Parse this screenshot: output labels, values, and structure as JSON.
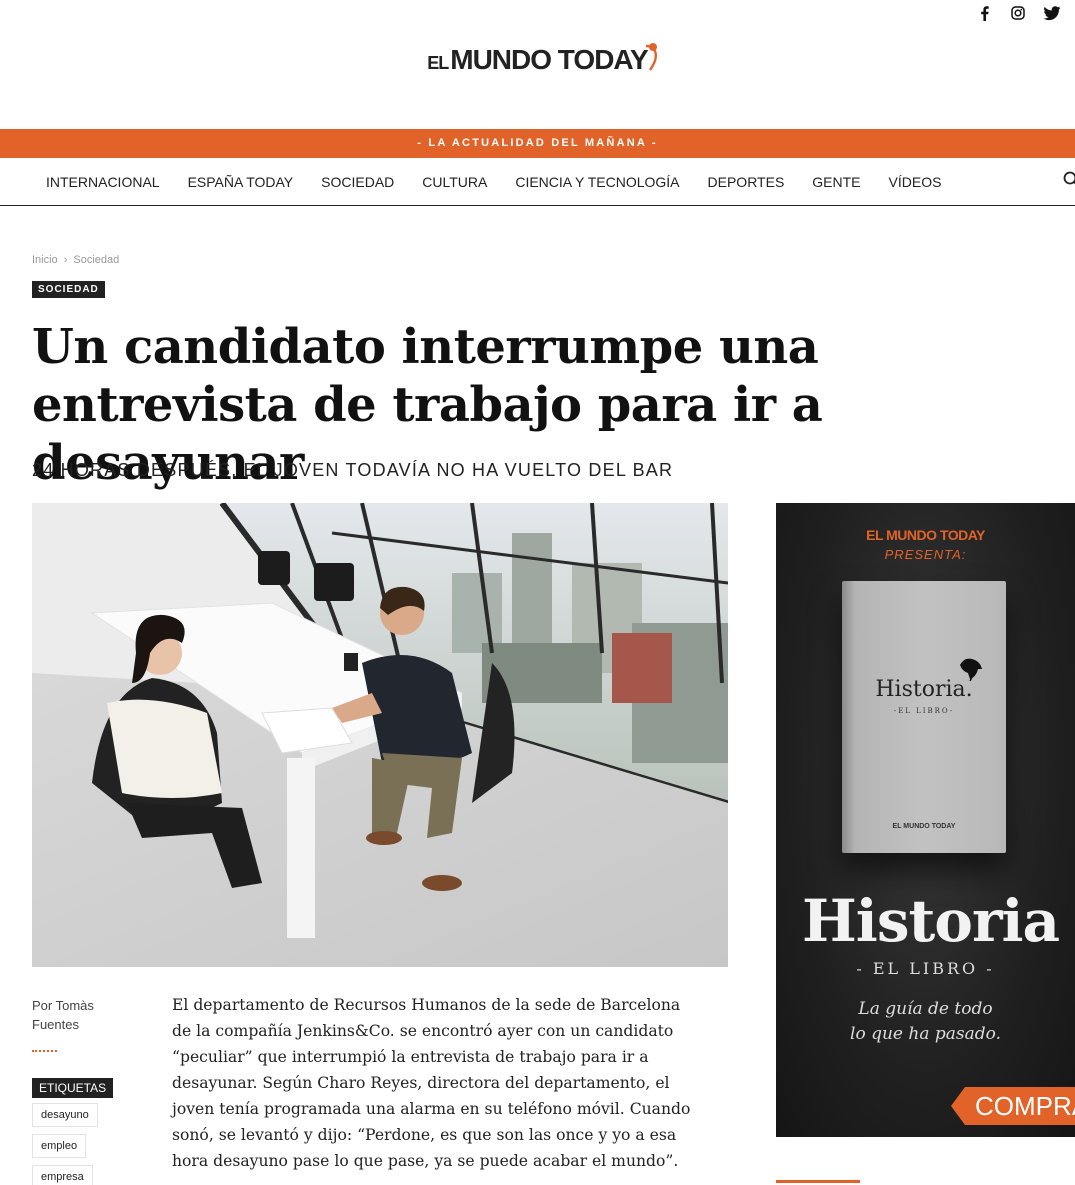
{
  "social": {
    "facebook_icon": "facebook-icon",
    "instagram_icon": "instagram-icon",
    "twitter_icon": "twitter-icon"
  },
  "logo": {
    "el": "EL",
    "main": "MUNDO TODAY",
    "color": "#222222",
    "accent": "#e2632a"
  },
  "tagline": "- LA ACTUALIDAD DEL MAÑANA  -",
  "nav": {
    "items": [
      {
        "label": "Internacional"
      },
      {
        "label": "España Today"
      },
      {
        "label": "Sociedad"
      },
      {
        "label": "Cultura"
      },
      {
        "label": "Ciencia y Tecnología"
      },
      {
        "label": "Deportes"
      },
      {
        "label": "Gente"
      },
      {
        "label": "Vídeos"
      }
    ],
    "search_icon": "search-icon"
  },
  "breadcrumb": {
    "home": "Inicio",
    "separator": "›",
    "current": "Sociedad"
  },
  "article": {
    "category": "SOCIEDAD",
    "title": "Un candidato interrumpe una entrevista de trabajo para ir a desayunar",
    "subtitle": "24 horas después, el joven todavía no ha vuelto del bar",
    "author": "Por Tomàs Fuentes",
    "body": "El departamento de Recursos Humanos de la sede de Barcelona de la compañía Jenkins&Co. se encontró ayer con un candidato “peculiar” que interrumpió la entrevista de trabajo para ir a desayunar. Según Charo Reyes, directora del departamento, el joven tenía programada una alarma en su teléfono móvil. Cuando sonó, se levantó y dijo: “Perdone, es que son las once y yo a esa hora desayuno pase lo que pase, ya se puede acabar el mundo”."
  },
  "tags": {
    "heading": "ETIQUETAS",
    "items": [
      "desayuno",
      "empleo",
      "empresa"
    ]
  },
  "ad": {
    "brand": "EL MUNDO TODAY",
    "presenta": "PRESENTA:",
    "book_title": "Historia.",
    "book_sub": "-EL LIBRO-",
    "book_brand": "EL MUNDO TODAY",
    "big_title": "Historia",
    "libro": "- EL LIBRO -",
    "guia_line1": "La guía de todo",
    "guia_line2": "lo que ha pasado.",
    "cta": "COMPRAR"
  }
}
